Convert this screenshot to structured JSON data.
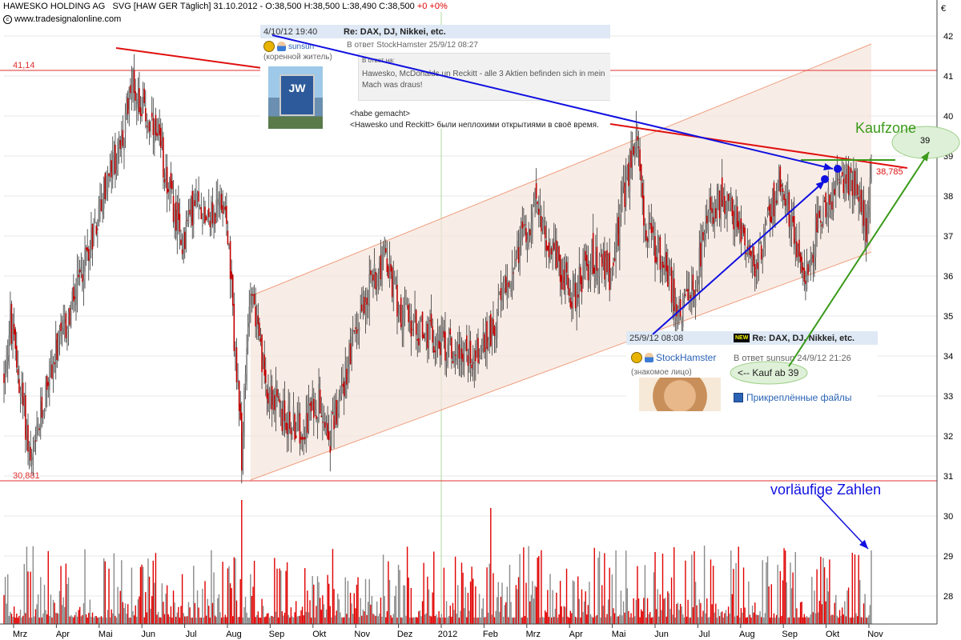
{
  "header": {
    "instrument": "HAWESKO HOLDING AG",
    "symbol_info": "SVG [HAW GER  Täglich] 31.10.2012 - O:38,500 H:38,500 L:38,490 C:38,500",
    "change": "+0 +0%",
    "site": "www.tradesignalonline.com"
  },
  "chart_data": {
    "type": "candlestick",
    "title": "HAWESKO HOLDING AG",
    "currency": "€",
    "ylim": [
      27.3,
      42.6
    ],
    "yticks": [
      28,
      29,
      30,
      31,
      32,
      33,
      34,
      35,
      36,
      37,
      38,
      39,
      40,
      41,
      42
    ],
    "xlabels": [
      "Mrz",
      "Apr",
      "Mai",
      "Jun",
      "Jul",
      "Aug",
      "Sep",
      "Okt",
      "Nov",
      "Dez",
      "2012",
      "Feb",
      "Mrz",
      "Apr",
      "Mai",
      "Jun",
      "Jul",
      "Aug",
      "Sep",
      "Okt",
      "Nov"
    ],
    "price_keypoints": [
      {
        "t": 0,
        "p": 33.5
      },
      {
        "t": 5,
        "p": 34.8
      },
      {
        "t": 15,
        "p": 32.8
      },
      {
        "t": 22,
        "p": 31.2
      },
      {
        "t": 35,
        "p": 33.5
      },
      {
        "t": 50,
        "p": 34.8
      },
      {
        "t": 65,
        "p": 36.5
      },
      {
        "t": 80,
        "p": 38.2
      },
      {
        "t": 95,
        "p": 39.5
      },
      {
        "t": 100,
        "p": 41.0
      },
      {
        "t": 112,
        "p": 40.0
      },
      {
        "t": 125,
        "p": 39.0
      },
      {
        "t": 140,
        "p": 36.8
      },
      {
        "t": 150,
        "p": 37.8
      },
      {
        "t": 165,
        "p": 37.5
      },
      {
        "t": 175,
        "p": 38.0
      },
      {
        "t": 182,
        "p": 34.5
      },
      {
        "t": 188,
        "p": 31.5
      },
      {
        "t": 195,
        "p": 36.0
      },
      {
        "t": 205,
        "p": 33.5
      },
      {
        "t": 220,
        "p": 32.5
      },
      {
        "t": 235,
        "p": 32.2
      },
      {
        "t": 250,
        "p": 33.0
      },
      {
        "t": 258,
        "p": 32.0
      },
      {
        "t": 270,
        "p": 33.5
      },
      {
        "t": 285,
        "p": 35.5
      },
      {
        "t": 300,
        "p": 36.5
      },
      {
        "t": 315,
        "p": 35.0
      },
      {
        "t": 335,
        "p": 34.5
      },
      {
        "t": 355,
        "p": 34.2
      },
      {
        "t": 375,
        "p": 34.0
      },
      {
        "t": 390,
        "p": 35.0
      },
      {
        "t": 405,
        "p": 36.5
      },
      {
        "t": 420,
        "p": 37.8
      },
      {
        "t": 435,
        "p": 36.5
      },
      {
        "t": 450,
        "p": 35.5
      },
      {
        "t": 465,
        "p": 36.5
      },
      {
        "t": 480,
        "p": 36.0
      },
      {
        "t": 490,
        "p": 38.0
      },
      {
        "t": 500,
        "p": 39.5
      },
      {
        "t": 508,
        "p": 37.0
      },
      {
        "t": 520,
        "p": 36.5
      },
      {
        "t": 535,
        "p": 35.0
      },
      {
        "t": 545,
        "p": 35.5
      },
      {
        "t": 558,
        "p": 37.5
      },
      {
        "t": 570,
        "p": 38.0
      },
      {
        "t": 585,
        "p": 37.0
      },
      {
        "t": 595,
        "p": 36.0
      },
      {
        "t": 605,
        "p": 37.5
      },
      {
        "t": 615,
        "p": 38.5
      },
      {
        "t": 625,
        "p": 37.0
      },
      {
        "t": 635,
        "p": 36.0
      },
      {
        "t": 645,
        "p": 37.5
      },
      {
        "t": 655,
        "p": 38.0
      },
      {
        "t": 665,
        "p": 38.5
      },
      {
        "t": 675,
        "p": 38.3
      },
      {
        "t": 682,
        "p": 37.2
      },
      {
        "t": 686,
        "p": 38.5
      }
    ],
    "horizontal_levels": [
      {
        "value": 41.14,
        "label": "41,14"
      },
      {
        "value": 30.881,
        "label": "30,881"
      }
    ],
    "channel_upper": [
      {
        "t": 195,
        "p": 35.5
      },
      {
        "t": 686,
        "p": 41.8
      }
    ],
    "channel_lower": [
      {
        "t": 195,
        "p": 30.9
      },
      {
        "t": 686,
        "p": 36.6
      }
    ],
    "resistance_1": [
      {
        "t": 88,
        "p": 41.7
      },
      {
        "t": 205,
        "p": 41.2
      }
    ],
    "resistance_2": [
      {
        "t": 480,
        "p": 39.8
      },
      {
        "t": 718,
        "p": 38.7
      }
    ],
    "resistance_label": "38,785",
    "buy_zone_level": 38.9,
    "buy_zone_label": "39",
    "volume_note": "volume bars in lower area, red = down day, gray = up day"
  },
  "annotations": {
    "kaufzone": "Kaufzone",
    "vorlaeufige": "vorläufige Zahlen",
    "kauf_ab": "<-- Kauf ab 39"
  },
  "post1": {
    "datetime": "4/10/12 19:40",
    "title": "Re: DAX, DJ, Nikkei, etc.",
    "user": "sunsun",
    "rank": "(коренной житель)",
    "reply_to": "В ответ StockHamster 25/9/12 08:27",
    "quote_header": "В ответ на:",
    "quote_text": "Hawesko, McDonalds un Reckitt - alle 3 Aktien befinden sich in mein Mach was draus!",
    "line1": "<habe gemacht>",
    "line2": "<Hawesko und Reckitt> были неплохими открытиями в своё время."
  },
  "post2": {
    "datetime": "25/9/12 08:08",
    "new_badge": "NEW",
    "title": "Re: DAX, DJ, Nikkei, etc.",
    "user": "StockHamster",
    "rank": "(знакомое лицо)",
    "reply_to": "В ответ sunsun 24/9/12 21:26",
    "files": "Прикреплённые файлы"
  },
  "colors": {
    "up": "#7f7f7f",
    "down": "#c00000",
    "hline": "#e03030",
    "channel": "#f0a080",
    "channel_fill": "#f5e4dc",
    "resistance": "#e01010",
    "blue": "#1010e0",
    "green": "#3a9a1a"
  }
}
